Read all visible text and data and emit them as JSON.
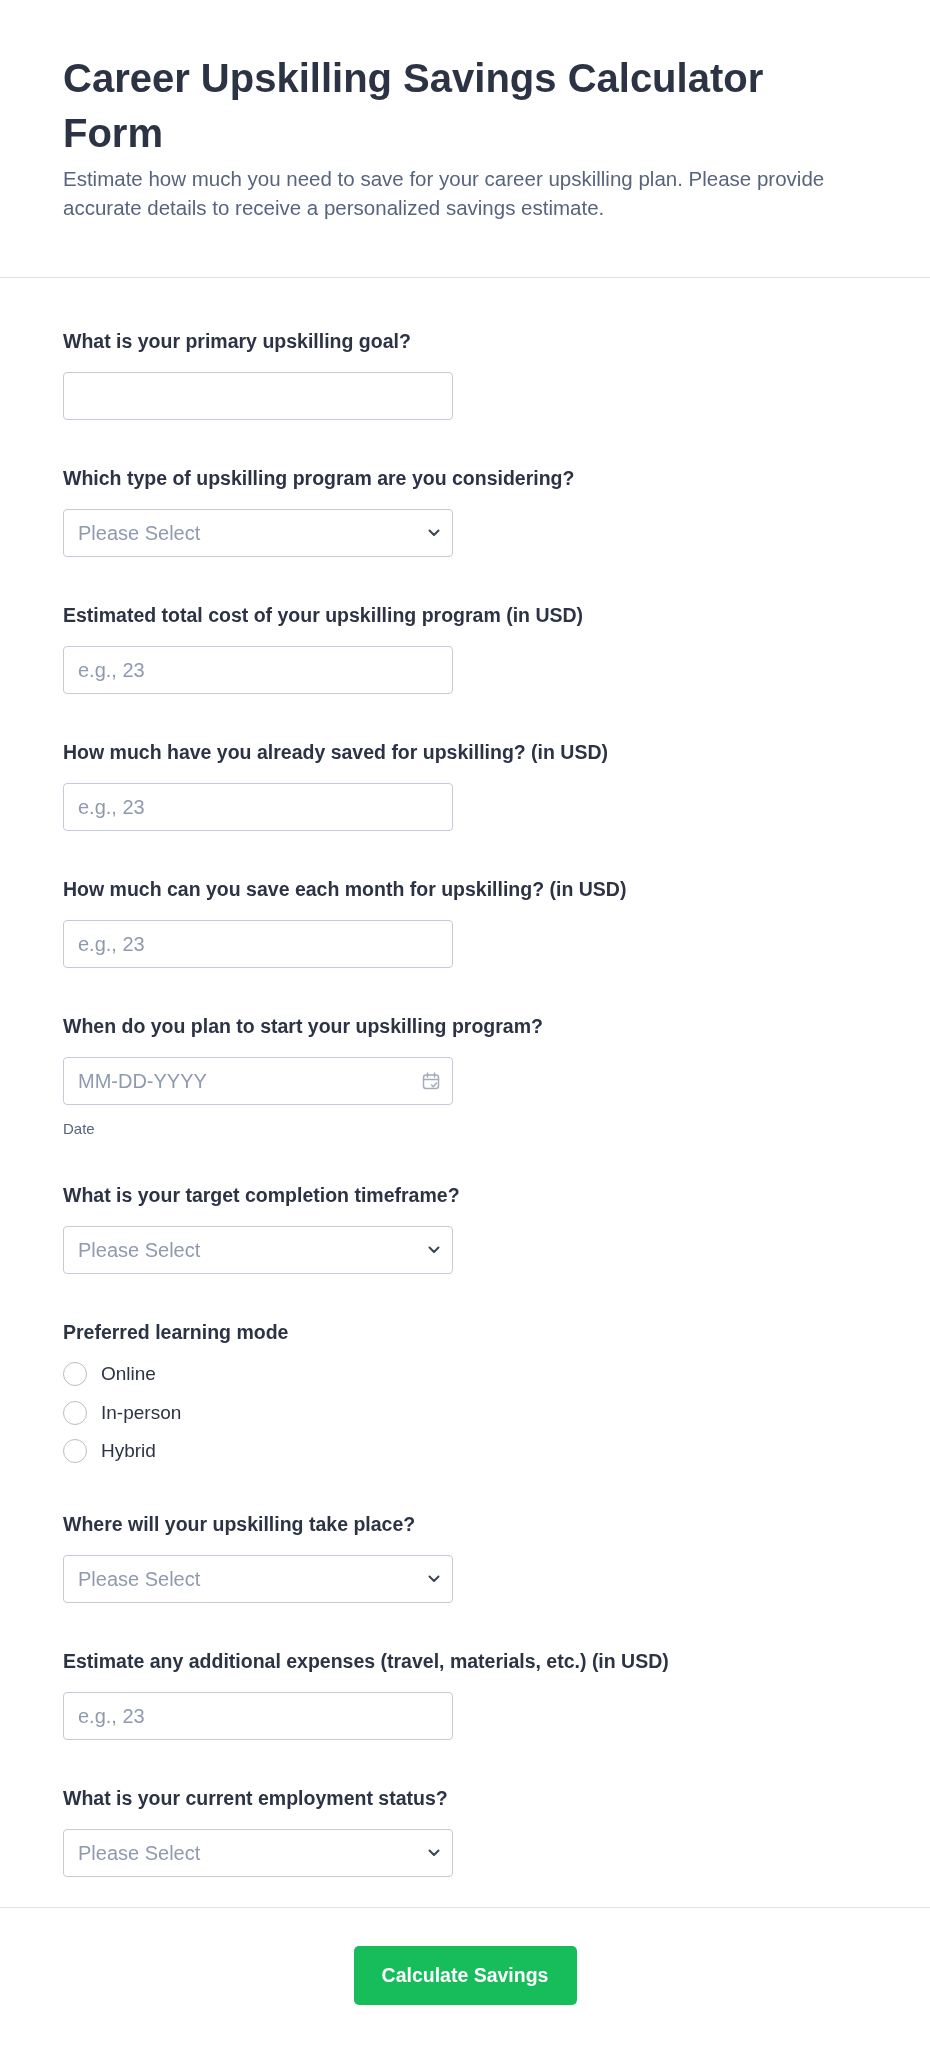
{
  "header": {
    "title": "Career Upskilling Savings Calculator Form",
    "description": "Estimate how much you need to save for your career upskilling plan. Please provide accurate details to receive a personalized savings estimate."
  },
  "fields": [
    {
      "kind": "text",
      "label": "What is your primary upskilling goal?"
    },
    {
      "kind": "select",
      "label": "Which type of upskilling program are you considering?",
      "placeholder": "Please Select"
    },
    {
      "kind": "text",
      "label": "Estimated total cost of your upskilling program (in USD)",
      "placeholder": "e.g., 23"
    },
    {
      "kind": "text",
      "label": "How much have you already saved for upskilling? (in USD)",
      "placeholder": "e.g., 23"
    },
    {
      "kind": "text",
      "label": "How much can you save each month for upskilling? (in USD)",
      "placeholder": "e.g., 23"
    },
    {
      "kind": "date",
      "label": "When do you plan to start your upskilling program?",
      "placeholder": "MM-DD-YYYY",
      "sublabel": "Date"
    },
    {
      "kind": "select",
      "label": "What is your target completion timeframe?",
      "placeholder": "Please Select"
    },
    {
      "kind": "radio",
      "label": "Preferred learning mode",
      "options": [
        {
          "label": "Online",
          "selected": false
        },
        {
          "label": "In-person",
          "selected": false
        },
        {
          "label": "Hybrid",
          "selected": false
        }
      ]
    },
    {
      "kind": "select",
      "label": "Where will your upskilling take place?",
      "placeholder": "Please Select"
    },
    {
      "kind": "text",
      "label": "Estimate any additional expenses (travel, materials, etc.) (in USD)",
      "placeholder": "e.g., 23"
    },
    {
      "kind": "select",
      "label": "What is your current employment status?",
      "placeholder": "Please Select"
    }
  ],
  "submit_button": {
    "label": "Calculate Savings"
  }
}
